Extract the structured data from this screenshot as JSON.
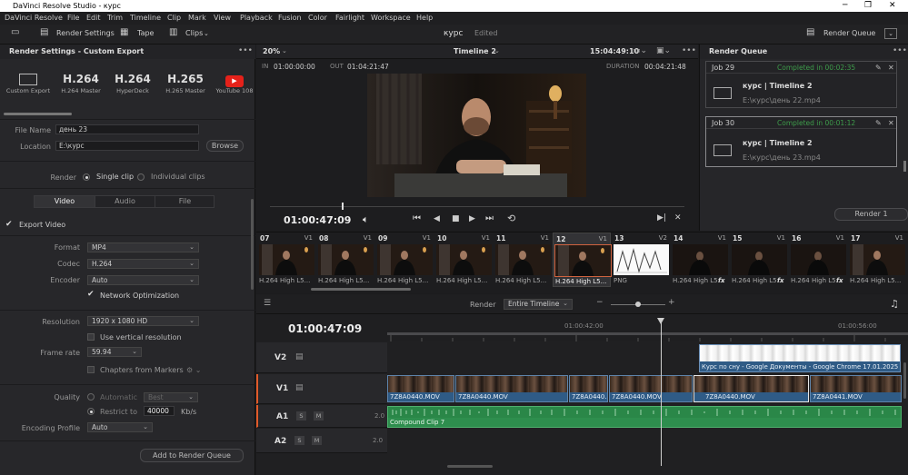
{
  "app": {
    "title": "DaVinci Resolve Studio - курс"
  },
  "menu": [
    "DaVinci Resolve",
    "File",
    "Edit",
    "Trim",
    "Timeline",
    "Clip",
    "Mark",
    "View",
    "Playback",
    "Fusion",
    "Color",
    "Fairlight",
    "Workspace",
    "Help"
  ],
  "toolbar": {
    "render_settings": "Render Settings",
    "tape": "Tape",
    "clips": "Clips",
    "project": "курс",
    "edited": "Edited",
    "render_queue": "Render Queue"
  },
  "render_settings": {
    "header": "Render Settings - Custom Export",
    "presets": [
      {
        "big": "",
        "small": "Custom Export",
        "icon": "film-icon"
      },
      {
        "big": "H.264",
        "small": "H.264 Master"
      },
      {
        "big": "H.264",
        "small": "HyperDeck"
      },
      {
        "big": "H.265",
        "small": "H.265 Master"
      },
      {
        "big": "",
        "small": "YouTube 108",
        "icon": "youtube-icon"
      }
    ],
    "file_name_label": "File Name",
    "file_name": "день 23",
    "location_label": "Location",
    "location": "E:\\курс",
    "browse": "Browse",
    "render_label": "Render",
    "single_clip": "Single clip",
    "individual_clips": "Individual clips",
    "tabs": [
      "Video",
      "Audio",
      "File"
    ],
    "export_video": "Export Video",
    "format_label": "Format",
    "format": "MP4",
    "codec_label": "Codec",
    "codec": "H.264",
    "encoder_label": "Encoder",
    "encoder": "Auto",
    "network_opt": "Network Optimization",
    "resolution_label": "Resolution",
    "resolution": "1920 x 1080 HD",
    "vertical_res": "Use vertical resolution",
    "frame_rate_label": "Frame rate",
    "frame_rate": "59.94",
    "chapters": "Chapters from Markers",
    "quality_label": "Quality",
    "automatic": "Automatic",
    "best": "Best",
    "restrict_to": "Restrict to",
    "bitrate": "40000",
    "kbs": "Kb/s",
    "encoding_profile_label": "Encoding Profile",
    "encoding_profile": "Auto",
    "add_to_queue": "Add to Render Queue"
  },
  "viewer": {
    "zoom": "20%",
    "timeline_name": "Timeline 2",
    "timecode_top": "15:04:49:10",
    "in_label": "IN",
    "in_tc": "01:00:00:00",
    "out_label": "OUT",
    "out_tc": "01:04:21:47",
    "duration_label": "DURATION",
    "duration_tc": "00:04:21:48",
    "current_tc": "01:00:47:09"
  },
  "render_queue": {
    "header": "Render Queue",
    "jobs": [
      {
        "id": "Job 29",
        "status": "Completed in 00:02:35",
        "title": "курс | Timeline 2",
        "path": "E:\\курс\\день 22.mp4"
      },
      {
        "id": "Job 30",
        "status": "Completed in 00:01:12",
        "title": "курс | Timeline 2",
        "path": "E:\\курс\\день 23.mp4"
      }
    ],
    "render_btn": "Render 1"
  },
  "thumbs": [
    {
      "num": "07",
      "track": "V1",
      "name": "H.264 High L5..."
    },
    {
      "num": "08",
      "track": "V1",
      "name": "H.264 High L5..."
    },
    {
      "num": "09",
      "track": "V1",
      "name": "H.264 High L5..."
    },
    {
      "num": "10",
      "track": "V1",
      "name": "H.264 High L5..."
    },
    {
      "num": "11",
      "track": "V1",
      "name": "H.264 High L5..."
    },
    {
      "num": "12",
      "track": "V1",
      "name": "H.264 High L5..."
    },
    {
      "num": "13",
      "track": "V2",
      "name": "PNG"
    },
    {
      "num": "14",
      "track": "V1",
      "name": "H.264 High L5..."
    },
    {
      "num": "15",
      "track": "V1",
      "name": "H.264 High L5..."
    },
    {
      "num": "16",
      "track": "V1",
      "name": "H.264 High L5..."
    },
    {
      "num": "17",
      "track": "V1",
      "name": "H.264 High L5..."
    }
  ],
  "timeline": {
    "render_label": "Render",
    "render_value": "Entire Timeline",
    "tc": "01:00:47:09",
    "ruler_left": "01:00:42:00",
    "ruler_right": "01:00:56:00",
    "tracks": [
      "V2",
      "V1",
      "A1",
      "A2"
    ],
    "a1_level": "2.0",
    "a2_level": "2.0",
    "v2_clip": "Курс по сну - Google Документы - Google Chrome 17.01.2025 14...",
    "v1_clips": [
      "7Z8A0440.MOV",
      "7Z8A0440.MOV",
      "7Z8A0440...",
      "7Z8A0440.MOV",
      "7Z8A0440.MOV",
      "7Z8A0441.MOV"
    ],
    "a1_clip": "Compound Clip 7"
  }
}
